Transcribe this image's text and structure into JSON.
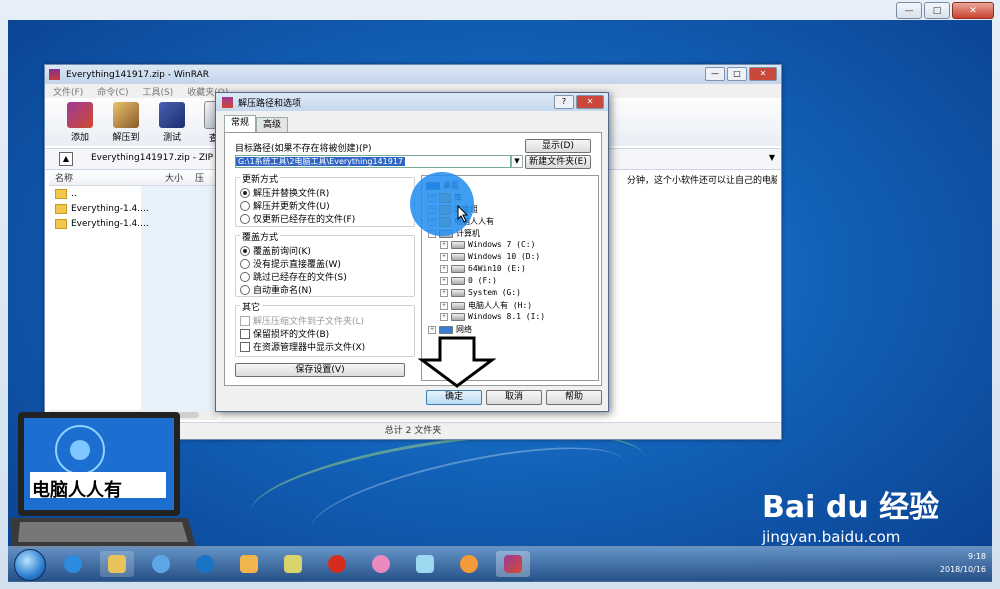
{
  "outer_frame": {
    "controls": [
      "—",
      "□",
      "✕"
    ]
  },
  "winrar": {
    "title": "Everything141917.zip - WinRAR",
    "controls": [
      "—",
      "□",
      "✕"
    ],
    "menu": [
      "文件(F)",
      "命令(C)",
      "工具(S)",
      "收藏夹(O)"
    ],
    "toolbar": [
      "添加",
      "解压到",
      "测试",
      "查看"
    ],
    "address": "Everything141917.zip - ZIP",
    "list_header": {
      "name": "名称",
      "size": "大小",
      "packed": "压"
    },
    "rows": [
      "..",
      "Everything-1.4....",
      "Everything-1.4...."
    ],
    "right_text": "分钟，这个小软件还可以让自己的电脑在",
    "status": "总计 2 文件夹"
  },
  "dialog": {
    "title": "解压路径和选项",
    "controls": [
      "?",
      "✕"
    ],
    "tabs": [
      "常规",
      "高级"
    ],
    "path_label": "目标路径(如果不存在将被创建)(P)",
    "path_value": "G:\\1系统工具\\2电脑工具\\Everything141917",
    "show_button": "显示(D)",
    "new_folder_button": "新建文件夹(E)",
    "update_group": {
      "title": "更新方式",
      "options": [
        "解压并替换文件(R)",
        "解压并更新文件(U)",
        "仅更新已经存在的文件(F)"
      ],
      "selected": 0
    },
    "overwrite_group": {
      "title": "覆盖方式",
      "options": [
        "覆盖前询问(K)",
        "没有提示直接覆盖(W)",
        "跳过已经存在的文件(S)",
        "自动重命名(N)"
      ],
      "selected": 0
    },
    "misc_group": {
      "title": "其它",
      "options": [
        "解压压缩文件到子文件夹(L)",
        "保留损坏的文件(B)",
        "在资源管理器中显示文件(X)"
      ]
    },
    "save_button": "保存设置(V)",
    "tree": {
      "root": "桌面",
      "items": [
        "库",
        "家庭组",
        "电脑人人有",
        "计算机"
      ],
      "drives": [
        "Windows 7 (C:)",
        "Windows 10 (D:)",
        "64Win10 (E:)",
        "0 (F:)",
        "System (G:)",
        "电脑人人有 (H:)",
        "Windows 8.1 (I:)"
      ],
      "network": "网络"
    },
    "ok_button": "确定",
    "cancel_button": "取消",
    "help_button": "帮助"
  },
  "watermark": {
    "logo_text": "电脑人人有",
    "baidu": "Bai du 经验",
    "baidu_url": "jingyan.baidu.com"
  },
  "tray": {
    "time": "9:18",
    "date": "2018/10/16"
  },
  "colors": {
    "desktop": "#1262b9",
    "highlight": "#1e8cf0",
    "selection": "#3166c5"
  }
}
